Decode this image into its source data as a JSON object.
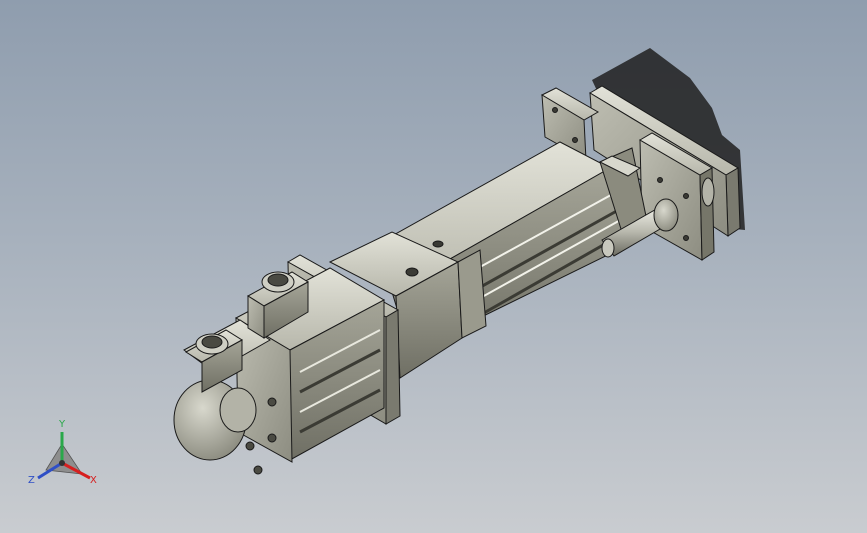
{
  "view": {
    "background_top": "#8f9dae",
    "background_bottom": "#c9ccd0",
    "model_color": "#c4c4b9",
    "edge_color": "#1a1a1a",
    "shadow_color": "#202020"
  },
  "triad": {
    "x_label": "X",
    "y_label": "Y",
    "z_label": "Z",
    "x_color": "#d61f1f",
    "y_color": "#2aa84a",
    "z_color": "#2f4fc6"
  }
}
